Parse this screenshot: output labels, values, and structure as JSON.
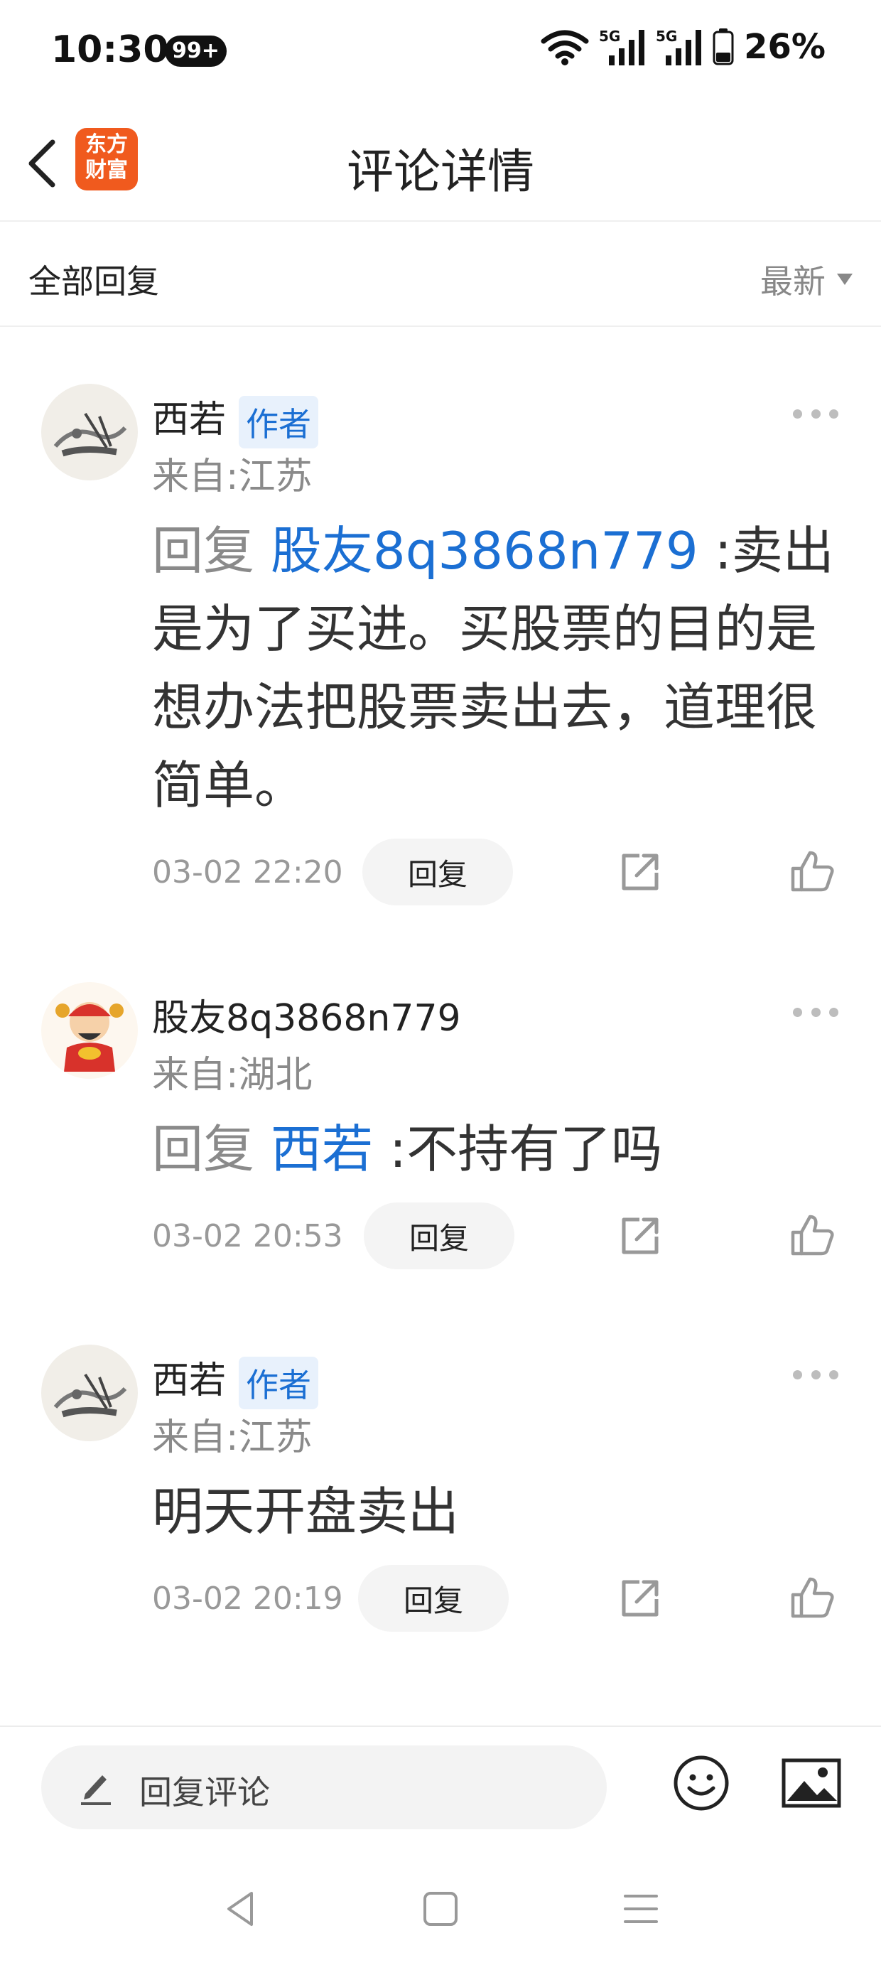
{
  "status_bar": {
    "time": "10:30",
    "notification_count": "99+",
    "signal_1": "5G",
    "signal_2": "5G",
    "battery": "26%"
  },
  "header": {
    "logo_line1": "东方",
    "logo_line2": "财富",
    "title": "评论详情"
  },
  "filter": {
    "left": "全部回复",
    "sort": "最新"
  },
  "comments": [
    {
      "author": "西若",
      "badge": "作者",
      "location": "来自:江苏",
      "reply_prefix": "回复",
      "mention": "股友8q3868n779",
      "colon": ":",
      "text": "卖出是为了买进。买股票的目的是想办法把股票卖出去，道理很简单。",
      "time": "03-02 22:20",
      "reply_label": "回复"
    },
    {
      "author": "股友8q3868n779",
      "badge": "",
      "location": "来自:湖北",
      "reply_prefix": "回复",
      "mention": "西若",
      "colon": ":",
      "text": "不持有了吗",
      "time": "03-02 20:53",
      "reply_label": "回复"
    },
    {
      "author": "西若",
      "badge": "作者",
      "location": "来自:江苏",
      "reply_prefix": "",
      "mention": "",
      "colon": "",
      "text": "明天开盘卖出",
      "time": "03-02 20:19",
      "reply_label": "回复"
    }
  ],
  "bottom": {
    "reply_placeholder": "回复评论"
  },
  "colors": {
    "accent": "#1b6fd3",
    "logo": "#f05a1e",
    "badge_bg": "#e8f1fc"
  },
  "icons": [
    "back-arrow-icon",
    "wifi-icon",
    "signal-icon",
    "battery-icon",
    "more-icon",
    "share-icon",
    "like-icon",
    "pen-icon",
    "emoji-icon",
    "image-icon",
    "nav-back-icon",
    "nav-home-icon",
    "nav-menu-icon"
  ]
}
